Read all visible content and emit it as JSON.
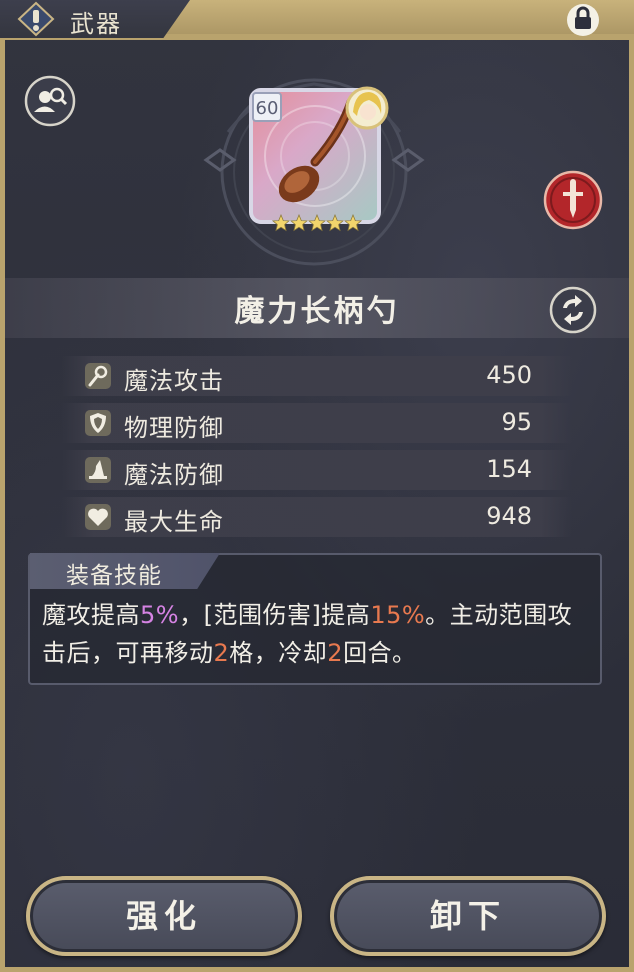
{
  "header": {
    "title": "武器",
    "warn_icon": "exclamation-diamond-icon",
    "lock_icon": "lock-icon"
  },
  "item": {
    "level": "60",
    "name": "魔力长柄勺",
    "stars": 5,
    "rarity_colors": {
      "card_frame": "#d8d7e6",
      "star": "#f2d56c"
    }
  },
  "stats": [
    {
      "icon": "staff-icon",
      "label": "魔法攻击",
      "value": "450"
    },
    {
      "icon": "shield-icon",
      "label": "物理防御",
      "value": "95"
    },
    {
      "icon": "wizard-hat-icon",
      "label": "魔法防御",
      "value": "154"
    },
    {
      "icon": "heart-icon",
      "label": "最大生命",
      "value": "948"
    }
  ],
  "skill": {
    "title": "装备技能",
    "parts": [
      "魔攻提高",
      "5%",
      "，[范围伤害]提高",
      "15%",
      "。主动范围攻击后，可再移动",
      "2",
      "格，冷却",
      "2",
      "回合。"
    ],
    "highlight_colors": {
      "purple": "#d583e3",
      "orange": "#e8794f"
    }
  },
  "buttons": {
    "enhance": "强化",
    "unequip": "卸下"
  },
  "colors": {
    "accent_gold": "#b9a36d",
    "background": "#2d2f3c",
    "sword_badge": "#b3262a"
  }
}
